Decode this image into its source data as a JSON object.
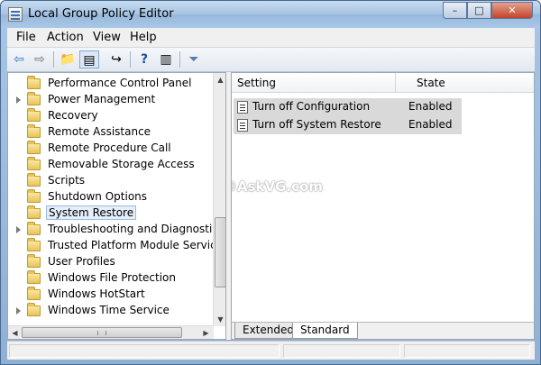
{
  "window": {
    "title": "Local Group Policy Editor",
    "minimize_glyph": "–",
    "maximize_glyph": "□",
    "close_glyph": "✕"
  },
  "menu": {
    "items": [
      "File",
      "Action",
      "View",
      "Help"
    ]
  },
  "toolbar": {
    "icons": [
      "back-arrow-icon",
      "forward-arrow-icon",
      "up-folder-icon",
      "show-hide-tree-icon",
      "export-list-icon",
      "help-icon",
      "show-hide-action-pane-icon",
      "filter-icon"
    ],
    "glyphs": {
      "back": "⇦",
      "forward": "⇨",
      "up": "📁",
      "tree": "▤",
      "export": "↪",
      "help": "?",
      "pane": "▥",
      "filter": "⏷"
    },
    "colors": {
      "back": "#2f74c4",
      "forward": "#6e6e6e",
      "help": "#1d4f9c",
      "filter": "#5a7ca8"
    }
  },
  "tree": {
    "items": [
      {
        "label": "Performance Control Panel",
        "expandable": false,
        "selected": false
      },
      {
        "label": "Power Management",
        "expandable": true,
        "selected": false
      },
      {
        "label": "Recovery",
        "expandable": false,
        "selected": false
      },
      {
        "label": "Remote Assistance",
        "expandable": false,
        "selected": false
      },
      {
        "label": "Remote Procedure Call",
        "expandable": false,
        "selected": false
      },
      {
        "label": "Removable Storage Access",
        "expandable": false,
        "selected": false
      },
      {
        "label": "Scripts",
        "expandable": false,
        "selected": false
      },
      {
        "label": "Shutdown Options",
        "expandable": false,
        "selected": false
      },
      {
        "label": "System Restore",
        "expandable": false,
        "selected": true
      },
      {
        "label": "Troubleshooting and Diagnostics",
        "expandable": true,
        "selected": false
      },
      {
        "label": "Trusted Platform Module Services",
        "expandable": false,
        "selected": false
      },
      {
        "label": "User Profiles",
        "expandable": false,
        "selected": false
      },
      {
        "label": "Windows File Protection",
        "expandable": false,
        "selected": false
      },
      {
        "label": "Windows HotStart",
        "expandable": false,
        "selected": false
      },
      {
        "label": "Windows Time Service",
        "expandable": true,
        "selected": false
      }
    ]
  },
  "list": {
    "columns": [
      "Setting",
      "State"
    ],
    "rows": [
      {
        "setting": "Turn off Configuration",
        "state": "Enabled"
      },
      {
        "setting": "Turn off System Restore",
        "state": "Enabled"
      }
    ]
  },
  "watermark": "©AskVG.com",
  "tabs": [
    "Extended",
    "Standard"
  ],
  "active_tab": "Standard"
}
